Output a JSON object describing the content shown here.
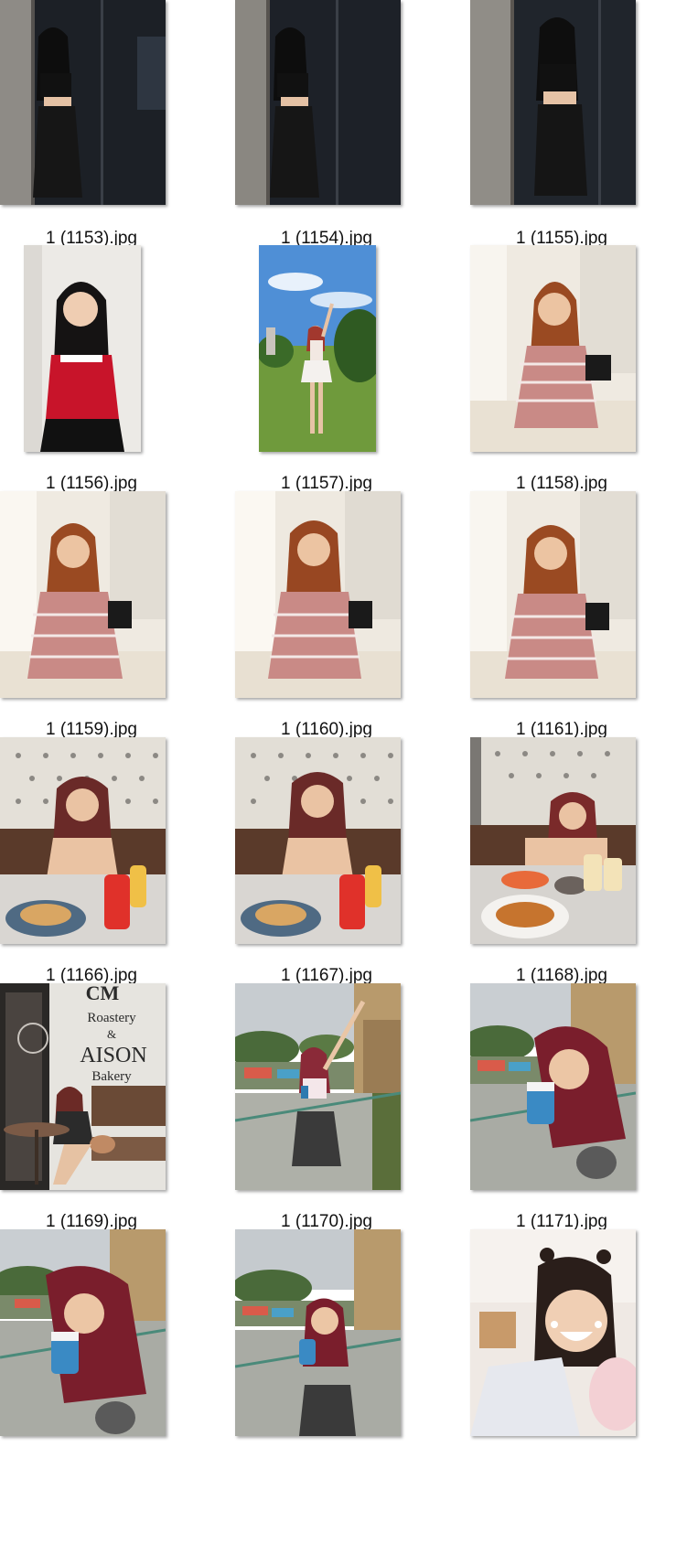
{
  "files": [
    {
      "name": "1 (1153).jpg",
      "scene": "dark-window-black-outfit"
    },
    {
      "name": "1 (1154).jpg",
      "scene": "dark-window-black-outfit"
    },
    {
      "name": "1 (1155).jpg",
      "scene": "dark-window-black-outfit"
    },
    {
      "name": "1 (1156).jpg",
      "scene": "portrait-red-shirt"
    },
    {
      "name": "1 (1157).jpg",
      "scene": "park-blue-sky"
    },
    {
      "name": "1 (1158).jpg",
      "scene": "bright-room-striped-sweater"
    },
    {
      "name": "1 (1159).jpg",
      "scene": "bright-room-striped-sweater"
    },
    {
      "name": "1 (1160).jpg",
      "scene": "bright-room-striped-sweater"
    },
    {
      "name": "1 (1161).jpg",
      "scene": "bright-room-striped-sweater"
    },
    {
      "name": "1 (1166).jpg",
      "scene": "cafe-table-food"
    },
    {
      "name": "1 (1167).jpg",
      "scene": "cafe-table-food"
    },
    {
      "name": "1 (1168).jpg",
      "scene": "cafe-table-pasta"
    },
    {
      "name": "1 (1169).jpg",
      "scene": "bakery-storefront",
      "sign_lines": [
        "CM",
        "Roastery",
        "&",
        "AISON",
        "Bakery"
      ]
    },
    {
      "name": "1 (1170).jpg",
      "scene": "balcony-railing"
    },
    {
      "name": "1 (1171).jpg",
      "scene": "balcony-railing"
    },
    {
      "name": "",
      "scene": "balcony-railing"
    },
    {
      "name": "",
      "scene": "balcony-railing"
    },
    {
      "name": "",
      "scene": "bedroom-selfie"
    }
  ]
}
